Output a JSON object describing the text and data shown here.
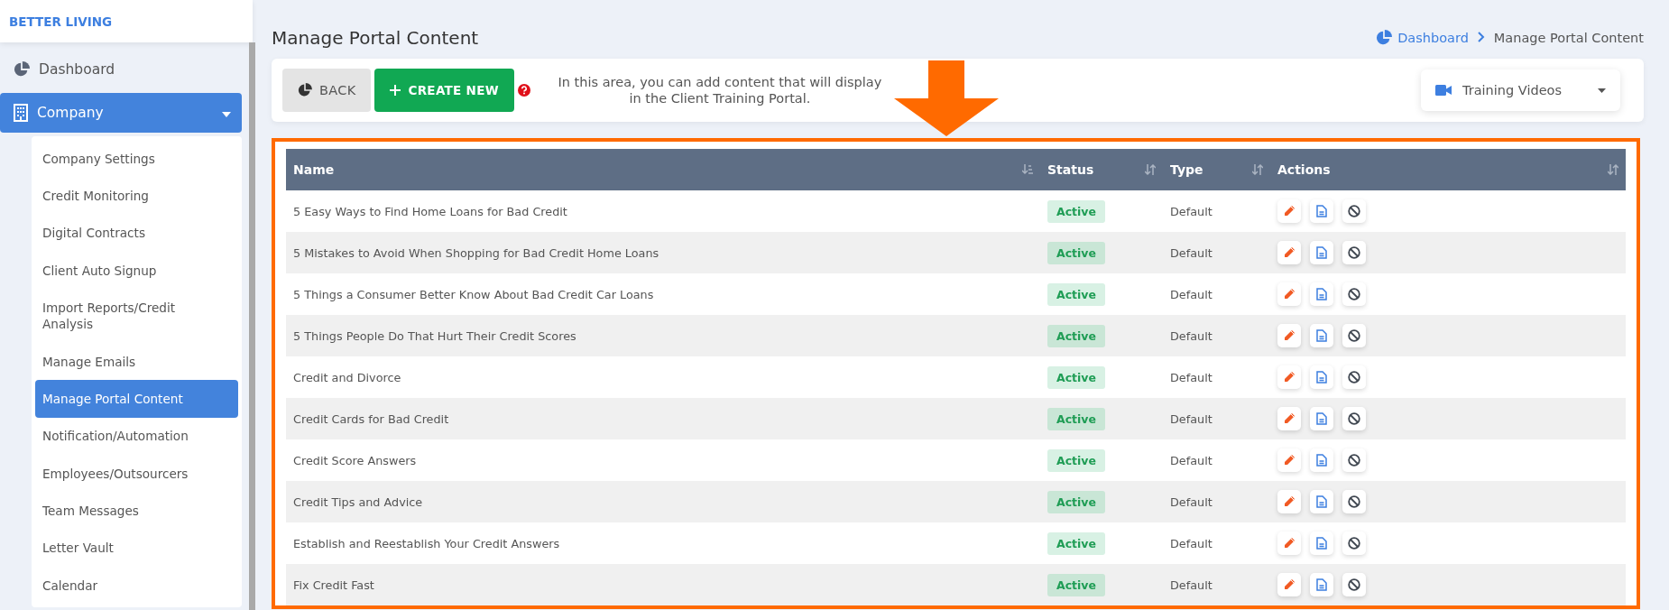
{
  "brand": "BETTER LIVING",
  "sidebar": {
    "items": [
      {
        "label": "Dashboard",
        "kind": "link",
        "selected": false
      },
      {
        "label": "Company",
        "kind": "group",
        "selected": true,
        "expanded": true,
        "children": [
          {
            "label": "Company Settings",
            "selected": false
          },
          {
            "label": "Credit Monitoring",
            "selected": false
          },
          {
            "label": "Digital Contracts",
            "selected": false
          },
          {
            "label": "Client Auto Signup",
            "selected": false
          },
          {
            "label": "Import Reports/Credit Analysis",
            "selected": false
          },
          {
            "label": "Manage Emails",
            "selected": false
          },
          {
            "label": "Manage Portal Content",
            "selected": true
          },
          {
            "label": "Notification/Automation",
            "selected": false
          },
          {
            "label": "Employees/Outsourcers",
            "selected": false
          },
          {
            "label": "Team Messages",
            "selected": false
          },
          {
            "label": "Letter Vault",
            "selected": false
          },
          {
            "label": "Calendar",
            "selected": false
          }
        ]
      }
    ]
  },
  "page": {
    "title": "Manage Portal Content",
    "breadcrumb": [
      {
        "label": "Dashboard",
        "kind": "link"
      },
      {
        "label": "Manage Portal Content",
        "kind": "current"
      }
    ]
  },
  "toolbar": {
    "back": "BACK",
    "create_new": "CREATE NEW",
    "description": "In this area, you can add content that will display in the Client Training Portal.",
    "dropdown": "Training Videos"
  },
  "table": {
    "columns": [
      {
        "label": "Name",
        "sorted": true
      },
      {
        "label": "Status",
        "sorted": false
      },
      {
        "label": "Type",
        "sorted": false
      },
      {
        "label": "Actions",
        "sorted": false
      }
    ],
    "rows": [
      {
        "name": "5 Easy Ways to Find Home Loans for Bad Credit",
        "status": "Active",
        "type": "Default"
      },
      {
        "name": "5 Mistakes to Avoid When Shopping for Bad Credit Home Loans",
        "status": "Active",
        "type": "Default"
      },
      {
        "name": "5 Things a Consumer Better Know About Bad Credit Car Loans",
        "status": "Active",
        "type": "Default"
      },
      {
        "name": "5 Things People Do That Hurt Their Credit Scores",
        "status": "Active",
        "type": "Default"
      },
      {
        "name": "Credit and Divorce",
        "status": "Active",
        "type": "Default"
      },
      {
        "name": "Credit Cards for Bad Credit",
        "status": "Active",
        "type": "Default"
      },
      {
        "name": "Credit Score Answers",
        "status": "Active",
        "type": "Default"
      },
      {
        "name": "Credit Tips and Advice",
        "status": "Active",
        "type": "Default"
      },
      {
        "name": "Establish and Reestablish Your Credit Answers",
        "status": "Active",
        "type": "Default"
      },
      {
        "name": "Fix Credit Fast",
        "status": "Active",
        "type": "Default"
      }
    ]
  }
}
